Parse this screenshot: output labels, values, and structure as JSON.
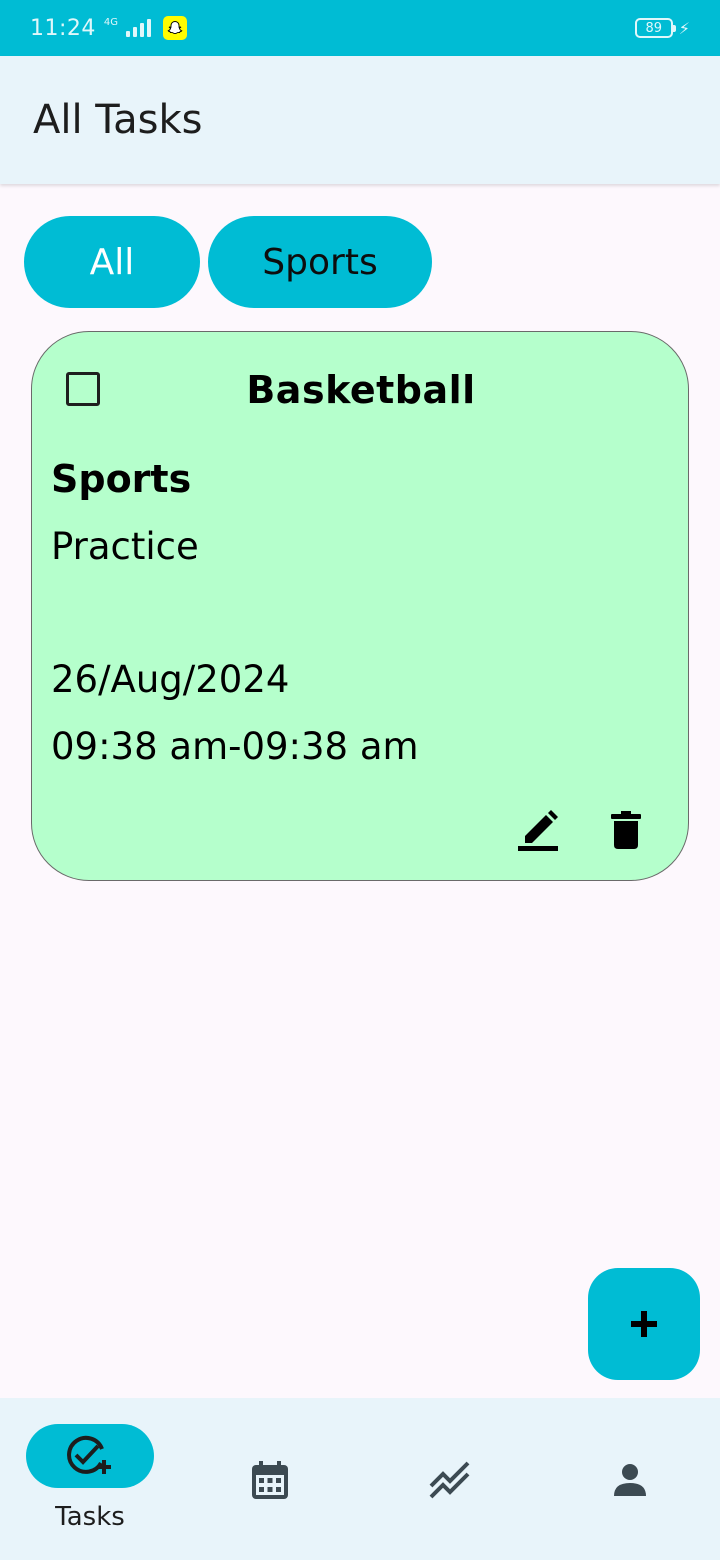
{
  "status_bar": {
    "time": "11:24",
    "network": "4G",
    "battery": "89"
  },
  "app_bar": {
    "title": "All Tasks"
  },
  "filters": [
    {
      "label": "All",
      "selected": true
    },
    {
      "label": "Sports",
      "selected": false
    }
  ],
  "task": {
    "title": "Basketball",
    "category": "Sports",
    "description": "Practice",
    "date": "26/Aug/2024",
    "time_range": "09:38 am-09:38 am",
    "completed": false,
    "card_color": "#b5ffcc"
  },
  "fab": {
    "icon": "plus-icon"
  },
  "bottom_nav": [
    {
      "label": "Tasks",
      "icon": "task-add-icon",
      "selected": true
    },
    {
      "label": "",
      "icon": "calendar-icon",
      "selected": false
    },
    {
      "label": "",
      "icon": "trend-icon",
      "selected": false
    },
    {
      "label": "",
      "icon": "person-icon",
      "selected": false
    }
  ],
  "colors": {
    "accent": "#00bcd4",
    "app_bar_bg": "#e8f4fa",
    "page_bg": "#fdf8fd"
  }
}
